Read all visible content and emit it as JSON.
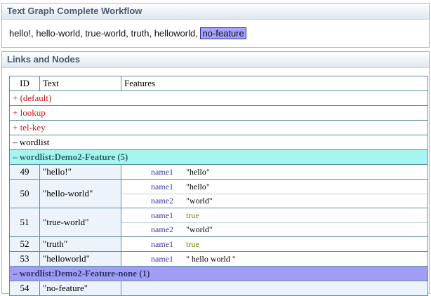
{
  "panel1": {
    "title": "Text Graph  Complete Workflow",
    "tokens": [
      "hello!",
      "hello-world",
      "true-world",
      "truth",
      "helloworld"
    ],
    "highlighted": "no-feature"
  },
  "panel2": {
    "title": "Links and Nodes",
    "headers": {
      "id": "ID",
      "text": "Text",
      "features": "Features"
    },
    "groups": [
      "+ (default)",
      "+ lookup",
      "+ tel-key",
      "– wordlist"
    ],
    "sub1": "– wordlist:Demo2-Feature (5)",
    "sub2": "– wordlist:Demo2-Feature-none (1)",
    "rows": [
      {
        "id": "49",
        "text": "\"hello!\"",
        "features": [
          {
            "name": "name1",
            "value": "\"hello\""
          }
        ]
      },
      {
        "id": "50",
        "text": "\"hello-world\"",
        "features": [
          {
            "name": "name1",
            "value": "\"hello\""
          },
          {
            "name": "name2",
            "value": "\"world\""
          }
        ]
      },
      {
        "id": "51",
        "text": "\"true-world\"",
        "features": [
          {
            "name": "name1",
            "value": "true"
          },
          {
            "name": "name2",
            "value": "\"world\""
          }
        ]
      },
      {
        "id": "52",
        "text": "\"truth\"",
        "features": [
          {
            "name": "name1",
            "value": "true"
          }
        ]
      },
      {
        "id": "53",
        "text": "\"helloworld\"",
        "features": [
          {
            "name": "name1",
            "value": "\" hello world \""
          }
        ]
      },
      {
        "id": "54",
        "text": "\"no-feature\"",
        "features": []
      }
    ]
  }
}
